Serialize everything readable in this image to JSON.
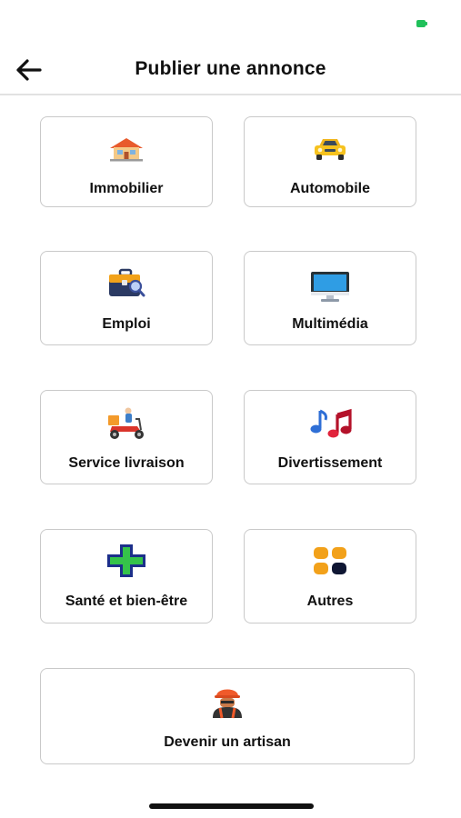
{
  "status_bar": {
    "battery_color": "#20c05a"
  },
  "header": {
    "title": "Publier une annonce",
    "back_icon": "arrow-left-icon"
  },
  "categories": [
    {
      "label": "Immobilier",
      "icon": "house-icon"
    },
    {
      "label": "Automobile",
      "icon": "car-icon"
    },
    {
      "label": "Emploi",
      "icon": "briefcase-icon"
    },
    {
      "label": "Multimédia",
      "icon": "monitor-icon"
    },
    {
      "label": "Service livraison",
      "icon": "delivery-scooter-icon"
    },
    {
      "label": "Divertissement",
      "icon": "music-notes-icon"
    },
    {
      "label": "Santé et bien-être",
      "icon": "medical-cross-icon"
    },
    {
      "label": "Autres",
      "icon": "grid-apps-icon"
    },
    {
      "label": "Devenir un artisan",
      "icon": "worker-icon"
    }
  ]
}
